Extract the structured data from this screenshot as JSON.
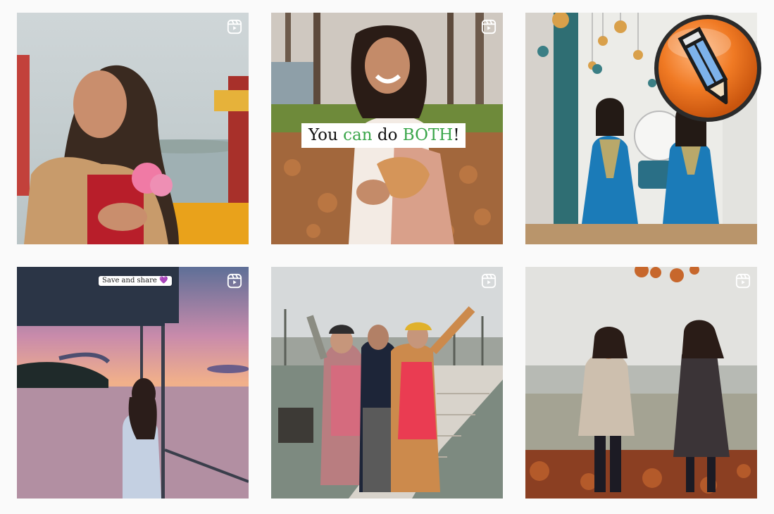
{
  "posts": [
    {
      "type": "reel",
      "icon": "reels-icon"
    },
    {
      "type": "reel",
      "icon": "reels-icon",
      "caption": {
        "before": "You ",
        "highlight_1": "can",
        "middle": " do ",
        "highlight_2": "BOTH",
        "after": "!"
      }
    },
    {
      "type": "reel",
      "icon": "reels-icon"
    },
    {
      "type": "reel",
      "icon": "reels-icon",
      "sticker": {
        "text": "Save and share",
        "emoji": "💜"
      }
    },
    {
      "type": "reel",
      "icon": "reels-icon"
    },
    {
      "type": "reel",
      "icon": "reels-icon"
    }
  ],
  "overlay": {
    "icon": "pencil-icon",
    "color": "#f07a24"
  },
  "colors": {
    "background": "#fafafa",
    "caption_highlight": "#3aa64a"
  }
}
